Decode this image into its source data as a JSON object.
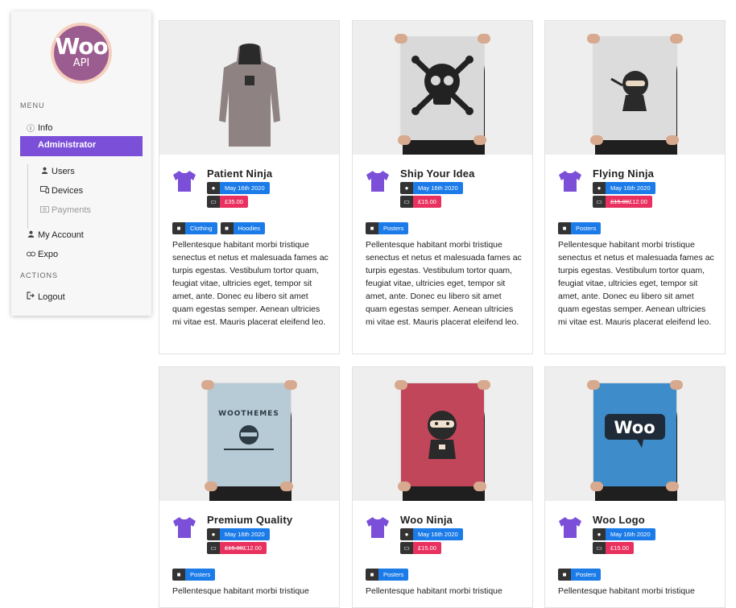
{
  "logo": {
    "line1": "Woo",
    "line2": "API"
  },
  "sidebar": {
    "menu_label": "MENU",
    "actions_label": "ACTIONS",
    "info": "Info",
    "administrator": "Administrator",
    "users": "Users",
    "devices": "Devices",
    "payments": "Payments",
    "my_account": "My Account",
    "expo": "Expo",
    "logout": "Logout"
  },
  "products": [
    {
      "name": "Patient Ninja",
      "date": "May 16th 2020",
      "price": "£35.00",
      "old_price": "",
      "tags": [
        "Clothing",
        "Hoodies"
      ],
      "desc": "Pellentesque habitant morbi tristique senectus et netus et malesuada fames ac turpis egestas. Vestibulum tortor quam, feugiat vitae, ultricies eget, tempor sit amet, ante. Donec eu libero sit amet quam egestas semper. Aenean ultricies mi vitae est. Mauris placerat eleifend leo."
    },
    {
      "name": "Ship Your Idea",
      "date": "May 16th 2020",
      "price": "£15.00",
      "old_price": "",
      "tags": [
        "Posters"
      ],
      "desc": "Pellentesque habitant morbi tristique senectus et netus et malesuada fames ac turpis egestas. Vestibulum tortor quam, feugiat vitae, ultricies eget, tempor sit amet, ante. Donec eu libero sit amet quam egestas semper. Aenean ultricies mi vitae est. Mauris placerat eleifend leo."
    },
    {
      "name": "Flying Ninja",
      "date": "May 16th 2020",
      "price": "£12.00",
      "old_price": "£15.00",
      "tags": [
        "Posters"
      ],
      "desc": "Pellentesque habitant morbi tristique senectus et netus et malesuada fames ac turpis egestas. Vestibulum tortor quam, feugiat vitae, ultricies eget, tempor sit amet, ante. Donec eu libero sit amet quam egestas semper. Aenean ultricies mi vitae est. Mauris placerat eleifend leo."
    },
    {
      "name": "Premium Quality",
      "date": "May 16th 2020",
      "price": "£12.00",
      "old_price": "£15.00",
      "tags": [
        "Posters"
      ],
      "desc": "Pellentesque habitant morbi tristique"
    },
    {
      "name": "Woo Ninja",
      "date": "May 16th 2020",
      "price": "£15.00",
      "old_price": "",
      "tags": [
        "Posters"
      ],
      "desc": "Pellentesque habitant morbi tristique"
    },
    {
      "name": "Woo Logo",
      "date": "May 16th 2020",
      "price": "£15.00",
      "old_price": "",
      "tags": [
        "Posters"
      ],
      "desc": "Pellentesque habitant morbi tristique"
    }
  ],
  "poster_text": {
    "woothemes": "WOOTHEMES",
    "woo_logo": "Woo"
  },
  "colors": {
    "accent": "#7b4fd8",
    "badge_blue": "#1b7be8",
    "badge_red": "#e8315e",
    "shirt": "#7b4fd8"
  }
}
